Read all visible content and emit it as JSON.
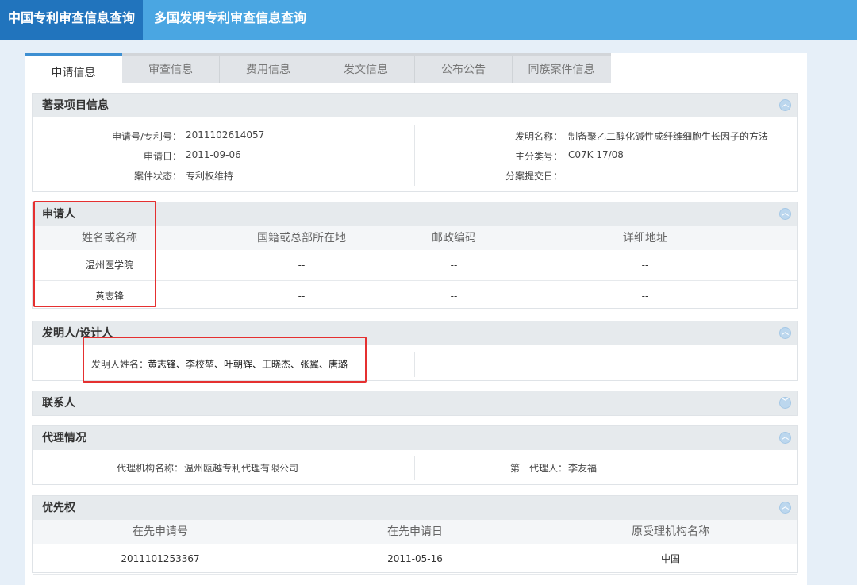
{
  "topnav": {
    "active": "中国专利审查信息查询",
    "other": "多国发明专利审查信息查询"
  },
  "tabs": [
    "申请信息",
    "审查信息",
    "费用信息",
    "发文信息",
    "公布公告",
    "同族案件信息"
  ],
  "biblio": {
    "title": "著录项目信息",
    "app_no_label": "申请号/专利号：",
    "app_no": "2011102614057",
    "app_date_label": "申请日：",
    "app_date": "2011-09-06",
    "status_label": "案件状态：",
    "status": "专利权维持",
    "invention_name_label": "发明名称：",
    "invention_name": "制备聚乙二醇化碱性成纤维细胞生长因子的方法",
    "main_class_label": "主分类号：",
    "main_class": "C07K 17/08",
    "divisional_label": "分案提交日：",
    "divisional": ""
  },
  "applicant": {
    "title": "申请人",
    "headers": [
      "姓名或名称",
      "国籍或总部所在地",
      "邮政编码",
      "详细地址"
    ],
    "rows": [
      [
        "温州医学院",
        "--",
        "--",
        "--"
      ],
      [
        "黄志锋",
        "--",
        "--",
        "--"
      ]
    ]
  },
  "inventor": {
    "title": "发明人/设计人",
    "label": "发明人姓名：",
    "names": "黄志锋、李校堃、叶朝辉、王晓杰、张翼、唐璐"
  },
  "contact": {
    "title": "联系人"
  },
  "agent": {
    "title": "代理情况",
    "org_label": "代理机构名称：",
    "org": "温州瓯越专利代理有限公司",
    "first_agent_label": "第一代理人：",
    "first_agent": "李友福"
  },
  "priority": {
    "title": "优先权",
    "headers": [
      "在先申请号",
      "在先申请日",
      "原受理机构名称"
    ],
    "rows": [
      [
        "2011101253367",
        "2011-05-16",
        "中国"
      ]
    ]
  },
  "colors": {
    "header_bar": "#4aa6e2",
    "active_tab": "#2174bd",
    "highlight": "#e53030"
  }
}
